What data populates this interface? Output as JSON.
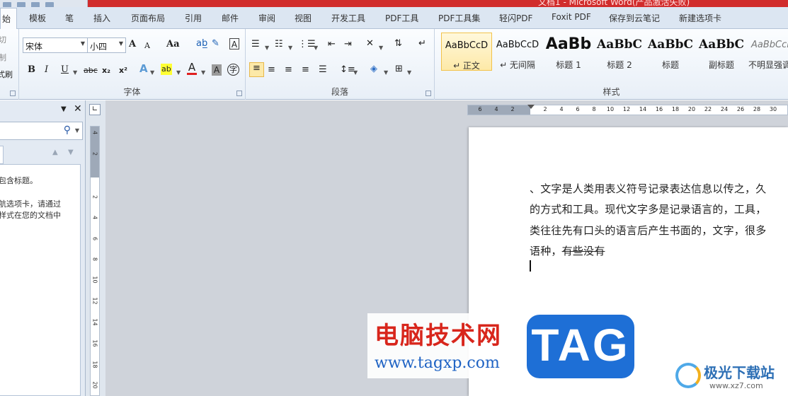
{
  "window": {
    "title_fragment": "文档1 - Microsoft Word(产品激活失败)"
  },
  "tabs": [
    {
      "label": "始",
      "active": true
    },
    {
      "label": "模板"
    },
    {
      "label": "笔"
    },
    {
      "label": "插入"
    },
    {
      "label": "页面布局"
    },
    {
      "label": "引用"
    },
    {
      "label": "邮件"
    },
    {
      "label": "审阅"
    },
    {
      "label": "视图"
    },
    {
      "label": "开发工具"
    },
    {
      "label": "PDF工具"
    },
    {
      "label": "PDF工具集"
    },
    {
      "label": "轻闪PDF"
    },
    {
      "label": "Foxit PDF"
    },
    {
      "label": "保存到云笔记"
    },
    {
      "label": "新建选项卡"
    }
  ],
  "clipboard": {
    "cut_fragment": "切",
    "copy_fragment": "制",
    "painter_fragment": "式刷"
  },
  "font": {
    "family_value": "宋体",
    "size_value": "小四",
    "group_label": "字体",
    "grow": "A",
    "shrink": "A",
    "change_case": "Aa",
    "bold": "B",
    "italic": "I",
    "underline": "U",
    "strike": "abc",
    "subscript": "x₂",
    "superscript": "x²",
    "text_effect": "A",
    "highlight": "ab",
    "font_color": "A",
    "char_shading": "A",
    "enclose": "字"
  },
  "paragraph": {
    "group_label": "段落"
  },
  "styles": {
    "group_label": "样式",
    "items": [
      {
        "sample": "AaBbCcD",
        "name": "↵ 正文",
        "selected": true
      },
      {
        "sample": "AaBbCcD",
        "name": "↵ 无间隔"
      },
      {
        "sample": "AaBb",
        "name": "标题 1"
      },
      {
        "sample": "AaBbC",
        "name": "标题 2"
      },
      {
        "sample": "AaBbC",
        "name": "标题"
      },
      {
        "sample": "AaBbC",
        "name": "副标题"
      },
      {
        "sample": "AaBbCcl",
        "name": "不明显强调"
      }
    ]
  },
  "navpane": {
    "search_icon": "search-icon",
    "message_line1": "包含标题。",
    "message_line2": "航选项卡，请通过",
    "message_line3": "样式在您的文档中"
  },
  "hruler_numbers": [
    "6",
    "4",
    "2",
    "2",
    "4",
    "6",
    "8",
    "10",
    "12",
    "14",
    "16",
    "18",
    "20",
    "22",
    "24",
    "26",
    "28",
    "30"
  ],
  "vruler_numbers": [
    "4",
    "2",
    "2",
    "4",
    "6",
    "8",
    "10",
    "12",
    "14",
    "16",
    "18",
    "20"
  ],
  "document": {
    "line1": "、文字是人类用表义符号记录表达信息以传之，久",
    "line2": "的方式和工具。现代文字多是记录语言的，工具，",
    "line3": "类往往先有口头的语言后产生书面的，文字，很多",
    "line4_plain": "语种，",
    "line4_struck": "有些没有"
  },
  "watermarks": {
    "site_cn": "电脑技术网",
    "site_url": "www.tagxp.com",
    "badge": "TAG",
    "brand_name": "极光下载站",
    "brand_url": "www.xz7.com"
  },
  "colors": {
    "title_red": "#d12c2c",
    "tab_bg": "#dce6f2",
    "selected_style": "#fde9a8",
    "watermark_red": "#d8261c",
    "watermark_blue": "#1e6fd6"
  }
}
